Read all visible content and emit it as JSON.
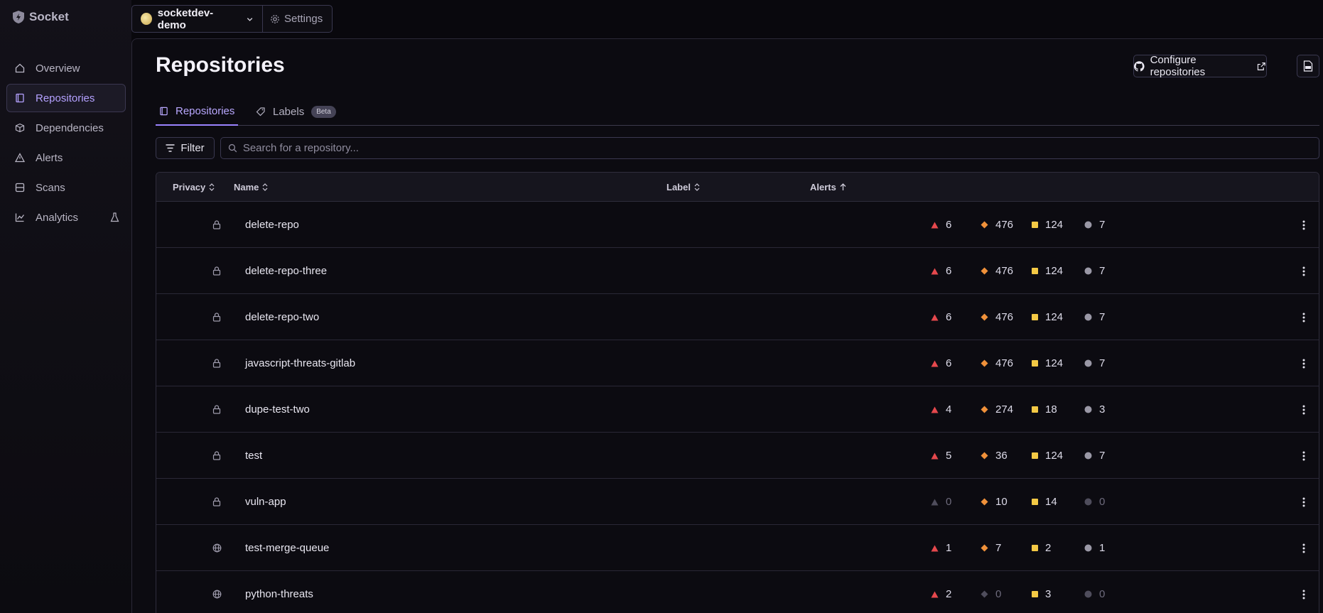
{
  "app": {
    "name": "Socket"
  },
  "sidebar": {
    "items": [
      {
        "label": "Overview",
        "icon": "home-icon"
      },
      {
        "label": "Repositories",
        "icon": "repo-icon",
        "active": true
      },
      {
        "label": "Dependencies",
        "icon": "package-icon"
      },
      {
        "label": "Alerts",
        "icon": "warning-icon"
      },
      {
        "label": "Scans",
        "icon": "scan-icon"
      },
      {
        "label": "Analytics",
        "icon": "chart-icon",
        "experimental": true
      }
    ]
  },
  "topbar": {
    "org_name": "socketdev-demo",
    "settings_label": "Settings"
  },
  "page": {
    "title": "Repositories",
    "configure_label": "Configure repositories",
    "tabs": [
      {
        "label": "Repositories",
        "active": true
      },
      {
        "label": "Labels",
        "badge": "Beta"
      }
    ],
    "filter_label": "Filter",
    "search_placeholder": "Search for a repository..."
  },
  "table": {
    "columns": {
      "privacy": "Privacy",
      "name": "Name",
      "label": "Label",
      "alerts": "Alerts"
    },
    "rows": [
      {
        "privacy": "private",
        "name": "delete-repo",
        "critical": "6",
        "high": "476",
        "medium": "124",
        "low": "7"
      },
      {
        "privacy": "private",
        "name": "delete-repo-three",
        "critical": "6",
        "high": "476",
        "medium": "124",
        "low": "7"
      },
      {
        "privacy": "private",
        "name": "delete-repo-two",
        "critical": "6",
        "high": "476",
        "medium": "124",
        "low": "7"
      },
      {
        "privacy": "private",
        "name": "javascript-threats-gitlab",
        "critical": "6",
        "high": "476",
        "medium": "124",
        "low": "7"
      },
      {
        "privacy": "private",
        "name": "dupe-test-two",
        "critical": "4",
        "high": "274",
        "medium": "18",
        "low": "3"
      },
      {
        "privacy": "private",
        "name": "test",
        "critical": "5",
        "high": "36",
        "medium": "124",
        "low": "7"
      },
      {
        "privacy": "private",
        "name": "vuln-app",
        "critical": "0",
        "high": "10",
        "medium": "14",
        "low": "0"
      },
      {
        "privacy": "public",
        "name": "test-merge-queue",
        "critical": "1",
        "high": "7",
        "medium": "2",
        "low": "1"
      },
      {
        "privacy": "public",
        "name": "python-threats",
        "critical": "2",
        "high": "0",
        "medium": "3",
        "low": "0"
      }
    ]
  },
  "colors": {
    "accent": "#9a83ff",
    "critical": "#e5484d",
    "high": "#f0913a",
    "medium": "#f3c945",
    "low": "#9a98a6"
  }
}
